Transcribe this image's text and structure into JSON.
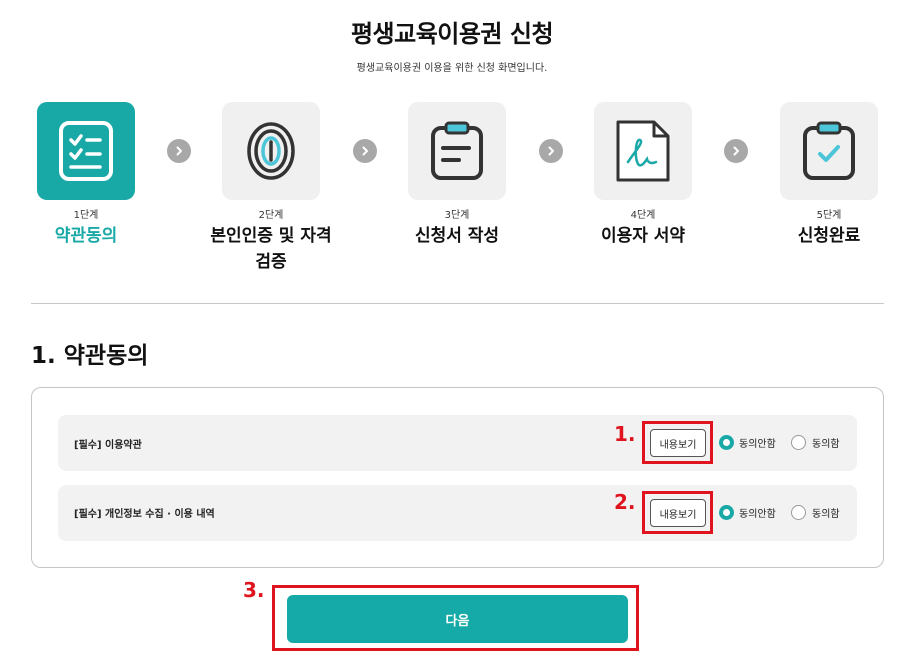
{
  "header": {
    "title": "평생교육이용권 신청",
    "subtitle": "평생교육이용권 이용을 위한 신청 화면입니다."
  },
  "steps": [
    {
      "number": "1단계",
      "name": "약관동의",
      "icon": "checklist-icon",
      "active": true
    },
    {
      "number": "2단계",
      "name": "본인인증 및 자격검증",
      "icon": "fingerprint-icon",
      "active": false
    },
    {
      "number": "3단계",
      "name": "신청서 작성",
      "icon": "clipboard-form-icon",
      "active": false
    },
    {
      "number": "4단계",
      "name": "이용자 서약",
      "icon": "signature-document-icon",
      "active": false
    },
    {
      "number": "5단계",
      "name": "신청완료",
      "icon": "clipboard-check-icon",
      "active": false
    }
  ],
  "section": {
    "title": "1. 약관동의"
  },
  "terms": [
    {
      "label": "[필수] 이용약관",
      "view_label": "내용보기",
      "agree_label": "동의안함",
      "disagree_label": "동의함",
      "selected": "동의안함"
    },
    {
      "label": "[필수] 개인정보 수집 · 이용 내역",
      "view_label": "내용보기",
      "agree_label": "동의안함",
      "disagree_label": "동의함",
      "selected": "동의안함"
    }
  ],
  "annotations": [
    "1.",
    "2.",
    "3."
  ],
  "next_button": {
    "label": "다음"
  },
  "colors": {
    "accent": "#18a9a7",
    "highlight": "#e0141e",
    "inactive_step": "#f0f0f0"
  }
}
